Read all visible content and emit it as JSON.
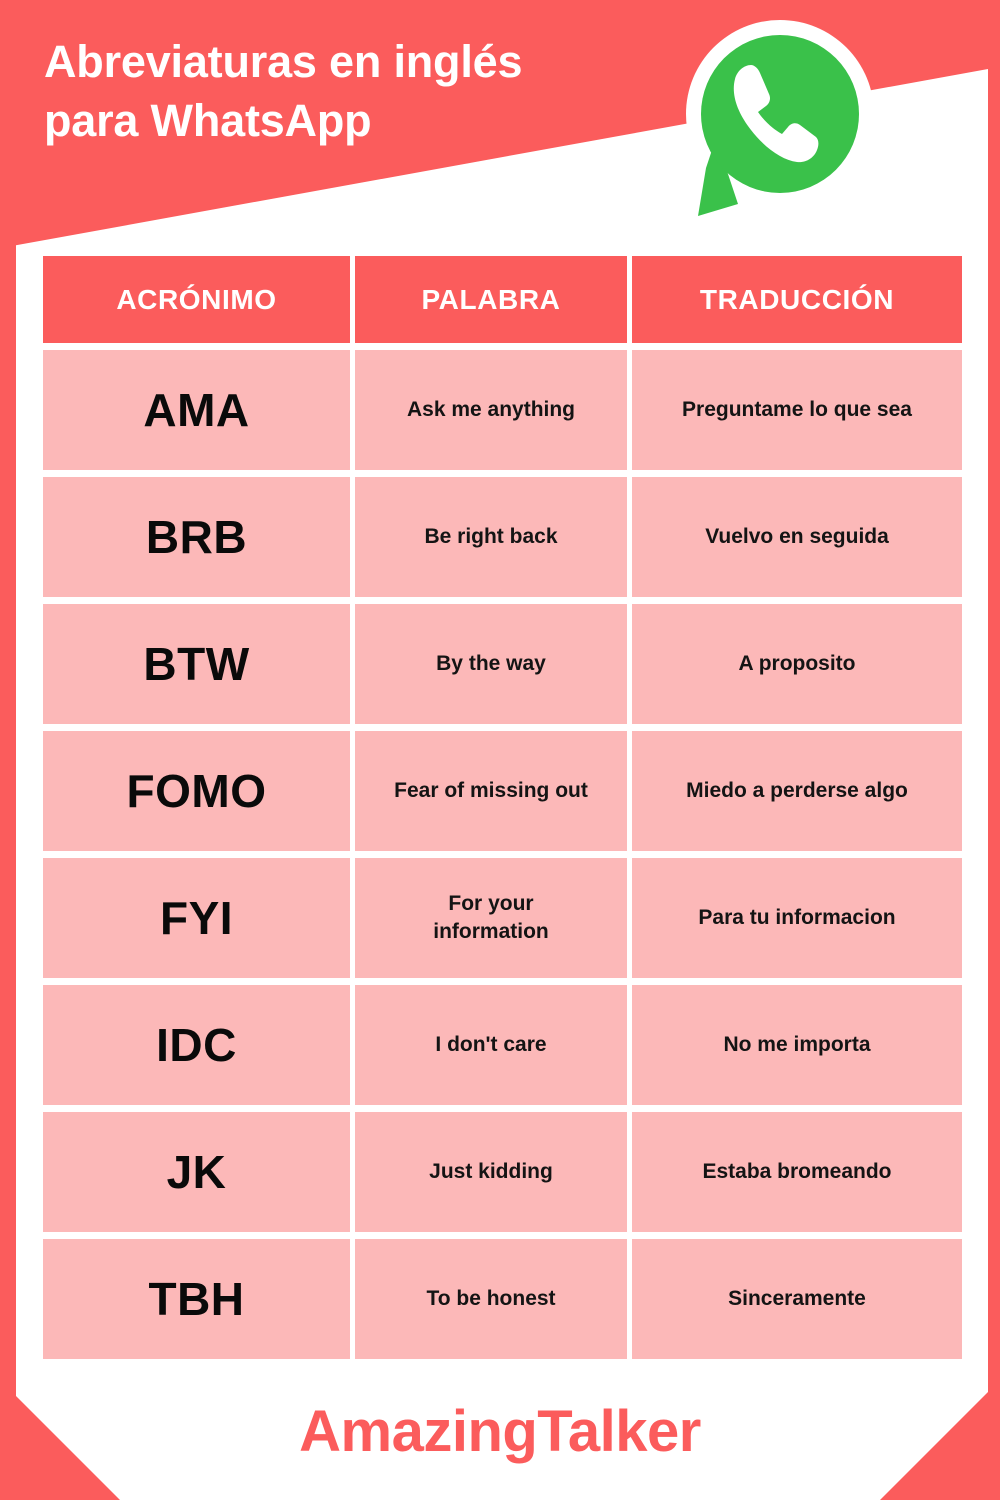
{
  "colors": {
    "coral": "#fb5c5c",
    "pink_cell": "#fcb8b8",
    "white": "#ffffff",
    "black_text": "#0a0a0a",
    "whatsapp_green": "#3ac14a"
  },
  "header": {
    "title": "Abreviaturas en inglés\npara WhatsApp",
    "logo_name": "whatsapp-logo"
  },
  "table": {
    "columns": [
      "ACRÓNIMO",
      "PALABRA",
      "TRADUCCIÓN"
    ],
    "rows": [
      {
        "acronym": "AMA",
        "word": "Ask me anything",
        "translation": "Preguntame lo que sea"
      },
      {
        "acronym": "BRB",
        "word": "Be right back",
        "translation": "Vuelvo en seguida"
      },
      {
        "acronym": "BTW",
        "word": "By the way",
        "translation": "A proposito"
      },
      {
        "acronym": "FOMO",
        "word": "Fear of missing out",
        "translation": "Miedo a perderse algo"
      },
      {
        "acronym": "FYI",
        "word": "For your\ninformation",
        "translation": "Para tu informacion"
      },
      {
        "acronym": "IDC",
        "word": "I don't care",
        "translation": "No me importa"
      },
      {
        "acronym": "JK",
        "word": "Just kidding",
        "translation": "Estaba bromeando"
      },
      {
        "acronym": "TBH",
        "word": "To be honest",
        "translation": "Sinceramente"
      }
    ]
  },
  "footer": {
    "brand": "AmazingTalker"
  }
}
